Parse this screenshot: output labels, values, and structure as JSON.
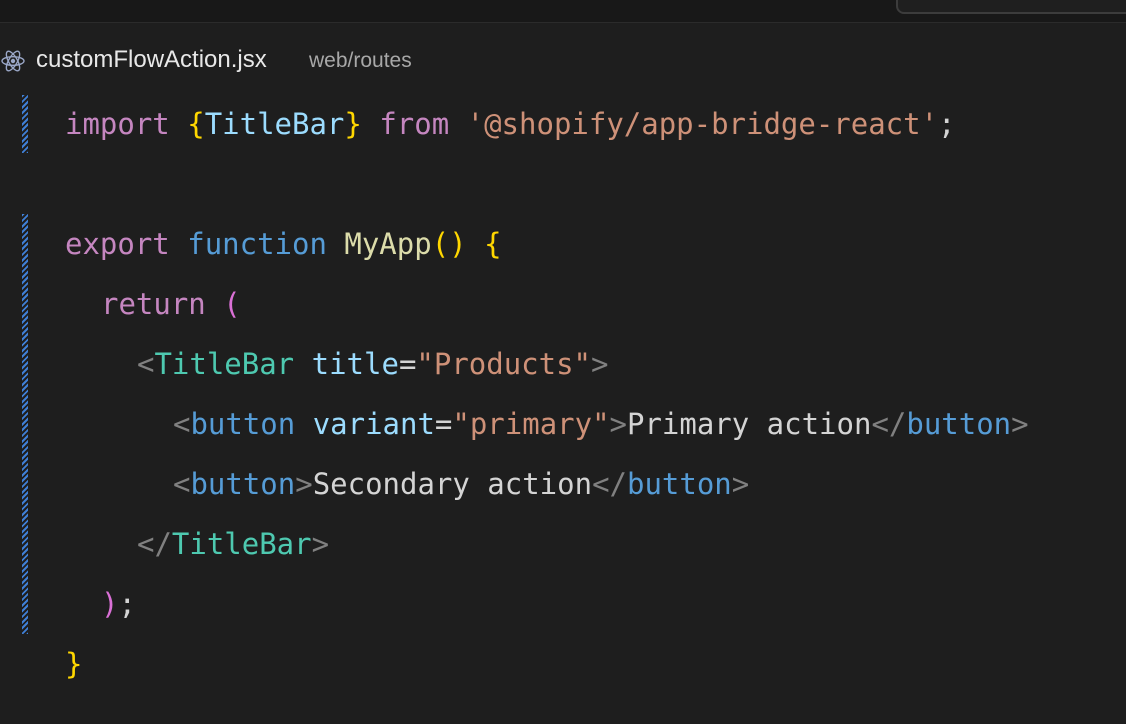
{
  "tab": {
    "filename": "customFlowAction.jsx",
    "path": "web/routes",
    "icon": "react-icon"
  },
  "code": {
    "line1": {
      "kw": "import",
      "brace_open": "{",
      "name": "TitleBar",
      "brace_close": "}",
      "from": "from",
      "module": "'@shopify/app-bridge-react'",
      "semi": ";"
    },
    "line3": {
      "export": "export",
      "function": "function",
      "name": "MyApp",
      "parens": "()",
      "brace": "{"
    },
    "line4": {
      "kw": "return",
      "paren": "("
    },
    "line5": {
      "lt": "<",
      "tag": "TitleBar",
      "attr": "title",
      "eq": "=",
      "value": "\"Products\"",
      "gt": ">"
    },
    "line6": {
      "lt": "<",
      "tag": "button",
      "attr": "variant",
      "eq": "=",
      "value": "\"primary\"",
      "gt": ">",
      "text": "Primary action",
      "close_lt": "</",
      "close_tag": "button",
      "close_gt": ">"
    },
    "line7": {
      "lt": "<",
      "tag": "button",
      "gt": ">",
      "text": "Secondary action",
      "close_lt": "</",
      "close_tag": "button",
      "close_gt": ">"
    },
    "line8": {
      "lt": "</",
      "tag": "TitleBar",
      "gt": ">"
    },
    "line9": {
      "paren": ")",
      "semi": ";"
    },
    "line10": {
      "brace": "}"
    }
  },
  "colors": {
    "background": "#1e1e1e",
    "keyword_control": "#c586c0",
    "keyword_declaration": "#569cd6",
    "bracket": "#ffd700",
    "string": "#ce9178",
    "function": "#dcdcaa",
    "component_tag": "#4ec9b0",
    "attribute": "#9cdcfe",
    "gutter_modified": "#3f7fd6"
  }
}
